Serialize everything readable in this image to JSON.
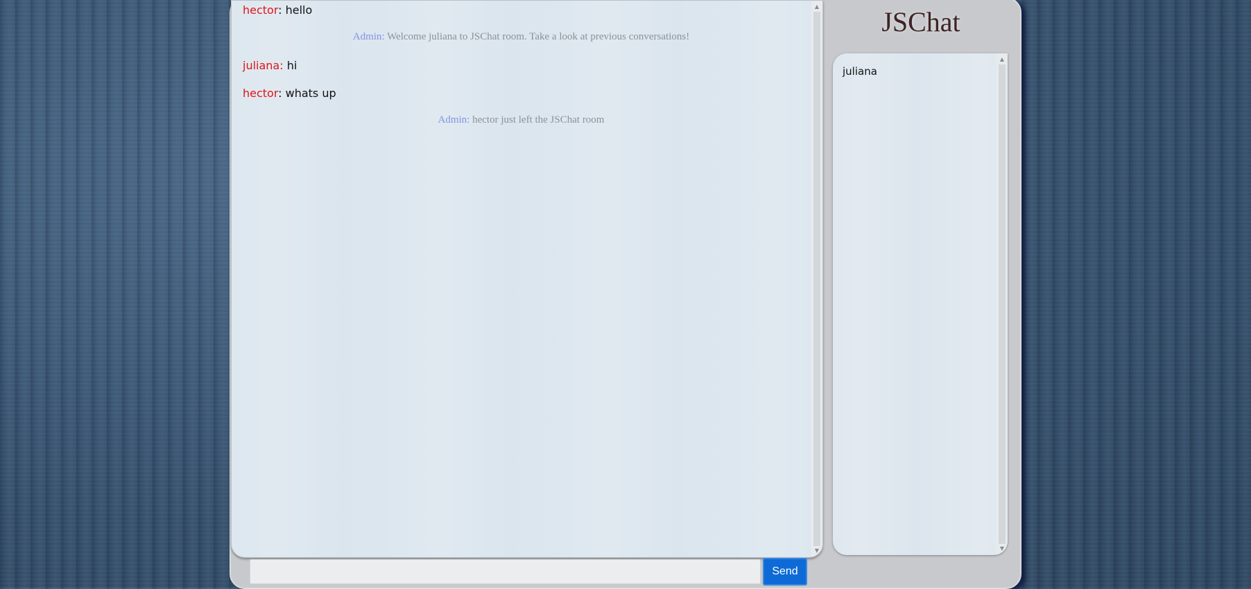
{
  "app": {
    "title": "JSChat"
  },
  "messages": [
    {
      "type": "user",
      "user": "hector",
      "text": "hello"
    },
    {
      "type": "admin",
      "user": "Admin",
      "text": "Welcome juliana to JSChat room. Take a look at previous conversations!"
    },
    {
      "type": "user",
      "user": "juliana",
      "text": "hi"
    },
    {
      "type": "user",
      "user": "hector",
      "text": "whats up"
    },
    {
      "type": "admin",
      "user": "Admin",
      "text": "hector just left the JSChat room"
    }
  ],
  "composer": {
    "value": "",
    "placeholder": "",
    "send_label": "Send"
  },
  "users": [
    {
      "name": "juliana"
    }
  ],
  "colors": {
    "accent": "#0d6ad6",
    "username": "#e0141a",
    "admin": "#7f93e6",
    "system_text": "#8b9198"
  },
  "icons": {
    "scroll_up": "scroll-up-arrow-icon",
    "scroll_down": "scroll-down-arrow-icon"
  }
}
